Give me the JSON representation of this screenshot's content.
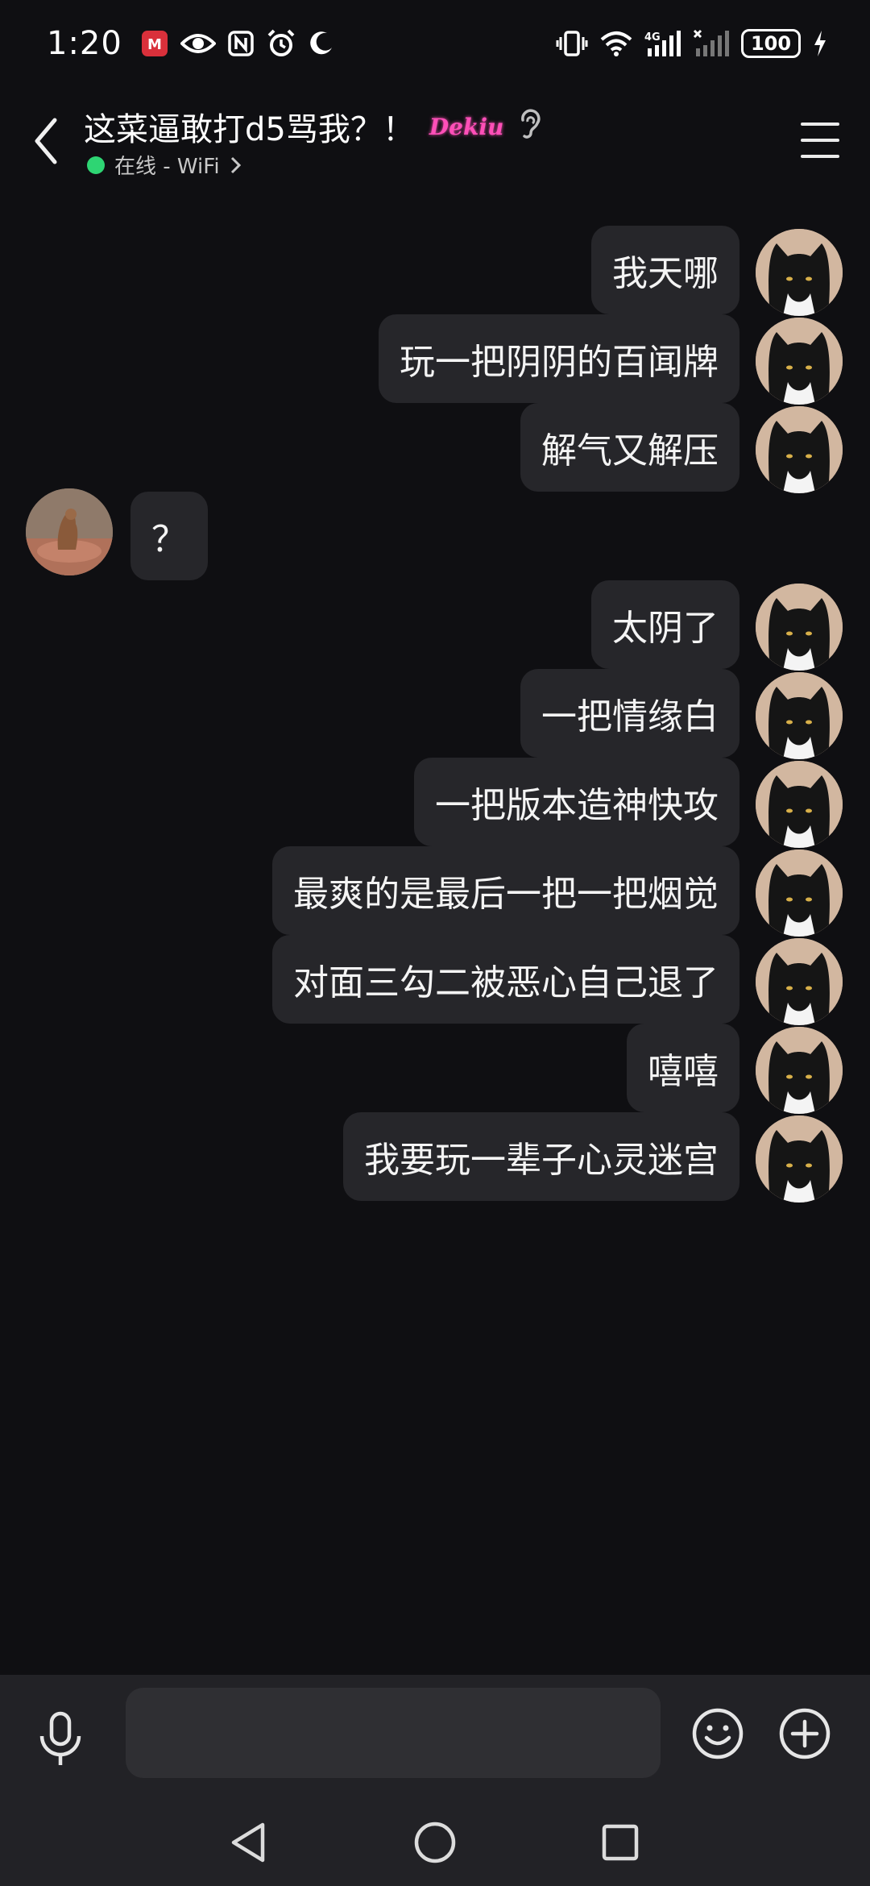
{
  "status_bar": {
    "time": "1:20",
    "network": "4G",
    "battery": "100"
  },
  "header": {
    "title": "这菜逼敢打d5骂我？！",
    "badge": "Dekiu",
    "status_text": "在线 - WiFi"
  },
  "messages": [
    {
      "side": "right",
      "text": "我天哪",
      "avatar": "cat-avatar"
    },
    {
      "side": "right",
      "text": "玩一把阴阴的百闻牌",
      "avatar": "cat-avatar"
    },
    {
      "side": "right",
      "text": "解气又解压",
      "avatar": "cat-avatar"
    },
    {
      "side": "left",
      "text": "？",
      "avatar": "dog-avatar"
    },
    {
      "side": "right",
      "text": "太阴了",
      "avatar": "cat-avatar"
    },
    {
      "side": "right",
      "text": "一把情缘白",
      "avatar": "cat-avatar"
    },
    {
      "side": "right",
      "text": "一把版本造神快攻",
      "avatar": "cat-avatar"
    },
    {
      "side": "right",
      "text": "最爽的是最后一把一把烟觉",
      "avatar": "cat-avatar"
    },
    {
      "side": "right",
      "text": "对面三勾二被恶心自己退了",
      "avatar": "cat-avatar"
    },
    {
      "side": "right",
      "text": "嘻嘻",
      "avatar": "cat-avatar"
    },
    {
      "side": "right",
      "text": "我要玩一辈子心灵迷宫",
      "avatar": "cat-avatar"
    }
  ],
  "input": {
    "placeholder": "",
    "value": ""
  },
  "colors": {
    "background": "#0f0f12",
    "bubble": "#26262a",
    "online": "#2ed573",
    "badge": "#ff4fb8"
  }
}
